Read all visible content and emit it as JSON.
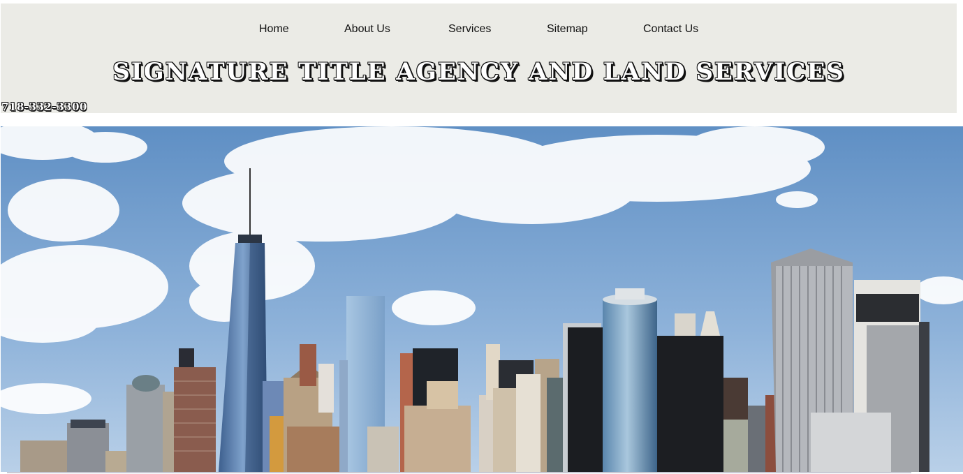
{
  "nav": {
    "items": [
      {
        "label": "Home"
      },
      {
        "label": "About Us"
      },
      {
        "label": "Services"
      },
      {
        "label": "Sitemap"
      },
      {
        "label": "Contact Us"
      }
    ]
  },
  "header": {
    "title": "SIGNATURE TITLE AGENCY AND LAND SERVICES",
    "phone": "718-332-3300"
  },
  "hero": {
    "image": "new-york-skyline-photo"
  },
  "colors": {
    "header_bg": "#ebebe6",
    "sky": "#7fa6d2"
  }
}
